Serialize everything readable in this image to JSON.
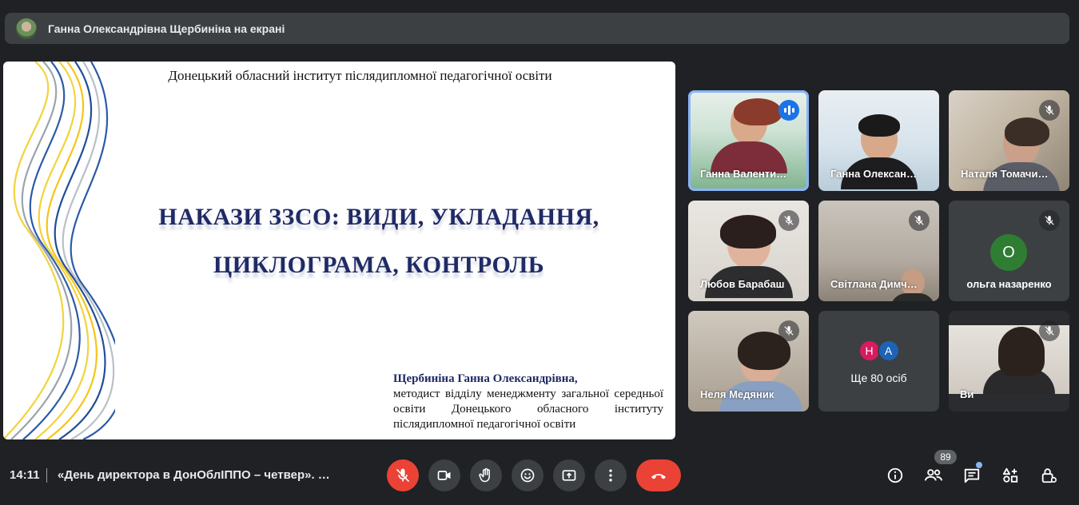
{
  "presenter_bar": {
    "text": "Ганна Олександрівна Щербиніна на екрані"
  },
  "slide": {
    "institute": "Донецький обласний інститут післядипломної педагогічної освіти",
    "title_line1": "НАКАЗИ ЗЗСО: ВИДИ, УКЛАДАННЯ,",
    "title_line2": "ЦИКЛОГРАМА, КОНТРОЛЬ",
    "author_name": "Щербиніна Ганна Олександрівна,",
    "author_role": "методист відділу менеджменту загальної середньої освіти Донецького обласного інституту післядипломної педагогічної освіти"
  },
  "participants": [
    {
      "name": "Ганна Валенти…",
      "state": "speaking"
    },
    {
      "name": "Ганна Олексан…",
      "state": "none"
    },
    {
      "name": "Наталя Томачи…",
      "state": "muted"
    },
    {
      "name": "Любов Барабаш",
      "state": "muted"
    },
    {
      "name": "Світлана Димч…",
      "state": "muted"
    },
    {
      "name": "ольга назаренко",
      "state": "muted",
      "initial": "О"
    },
    {
      "name": "Неля Медяник",
      "state": "muted"
    },
    {
      "name": "Ви",
      "state": "muted"
    }
  ],
  "more": {
    "label": "Ще 80 осіб",
    "initials": [
      "Н",
      "А"
    ],
    "colors": [
      "#d81b60",
      "#1e63b7"
    ]
  },
  "bottom": {
    "time": "14:11",
    "meeting_title": "«День директора в ДонОблІППО – четвер». …",
    "people_count": "89"
  },
  "colors": {
    "end_call": "#ea4335",
    "mic_off": "#ea4335",
    "speaking": "#1a73e8"
  }
}
